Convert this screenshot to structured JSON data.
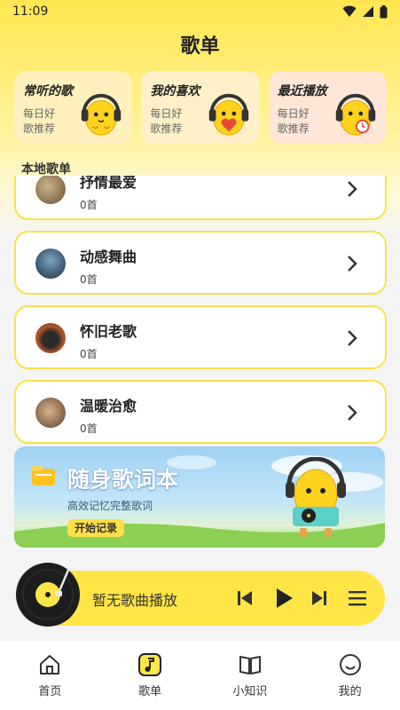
{
  "status_bar": {
    "time": "11:09"
  },
  "page": {
    "title": "歌单"
  },
  "cards": [
    {
      "title": "常听的歌",
      "subtitle": "每日好歌推荐"
    },
    {
      "title": "我的喜欢",
      "subtitle": "每日好歌推荐"
    },
    {
      "title": "最近播放",
      "subtitle": "每日好歌推荐"
    }
  ],
  "section": {
    "local_label": "本地歌单"
  },
  "playlists": [
    {
      "name": "抒情最爱",
      "count": "0首"
    },
    {
      "name": "动感舞曲",
      "count": "0首"
    },
    {
      "name": "怀旧老歌",
      "count": "0首"
    },
    {
      "name": "温暖治愈",
      "count": "0首"
    }
  ],
  "banner": {
    "title": "随身歌词本",
    "subtitle": "高效记忆完整歌词",
    "button": "开始记录"
  },
  "player": {
    "status": "暂无歌曲播放"
  },
  "tabs": [
    {
      "label": "首页",
      "icon": "home-icon"
    },
    {
      "label": "歌单",
      "icon": "music-note-icon"
    },
    {
      "label": "小知识",
      "icon": "book-icon"
    },
    {
      "label": "我的",
      "icon": "smile-icon"
    }
  ],
  "colors": {
    "accent": "#ffe646",
    "border": "#f6e24a"
  }
}
